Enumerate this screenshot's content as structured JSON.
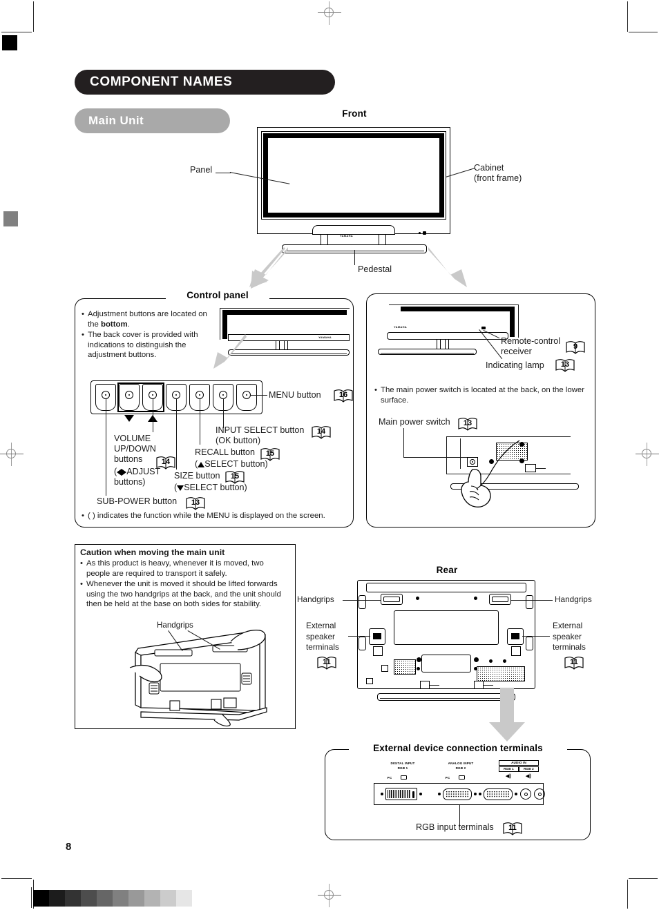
{
  "page": {
    "number": "8",
    "section_title": "COMPONENT NAMES",
    "subsection_title": "Main Unit",
    "brand_logo": "YAMAHA"
  },
  "front": {
    "title": "Front",
    "labels": {
      "panel": "Panel",
      "cabinet": "Cabinet\n(front frame)",
      "pedestal": "Pedestal"
    }
  },
  "control_panel": {
    "title": "Control panel",
    "notes": [
      "Adjustment buttons are located on the bottom.",
      "The back cover is provided with indications to distinguish the adjustment buttons."
    ],
    "note1_pre": "Adjustment buttons are located on the ",
    "note1_bold": "bottom",
    "note1_post": ".",
    "note2": "The back cover is provided with indications to distinguish the adjustment buttons.",
    "callouts": {
      "menu": {
        "label": "MENU button",
        "page": "16"
      },
      "input_select": {
        "label": "INPUT SELECT button\n(OK button)",
        "page": "14"
      },
      "recall": {
        "label": "RECALL button",
        "sub": "SELECT button)",
        "page": "15"
      },
      "size": {
        "label": "SIZE button",
        "sub": "SELECT button)",
        "page": "15"
      },
      "volume": {
        "label": "VOLUME\nUP/DOWN\nbuttons",
        "sub_open": "(",
        "sub_text": "ADJUST\nbuttons)",
        "page": "14"
      },
      "sub_power": {
        "label": "SUB-POWER button",
        "page": "13"
      }
    },
    "footnote": "(    ) indicates the function while the MENU is displayed on the screen."
  },
  "rear_top_panel": {
    "callouts": {
      "remote_receiver": {
        "label": "Remote-control\nreceiver",
        "page": "9"
      },
      "indicating_lamp": {
        "label": "Indicating lamp",
        "page": "13"
      },
      "main_power_switch": {
        "label": "Main power switch",
        "page": "13"
      }
    },
    "note": "The main power switch is located at the back, on the lower surface."
  },
  "caution": {
    "title": "Caution when moving the main unit",
    "items": [
      "As this product is heavy, whenever it is moved, two people are required to transport it safely.",
      "Whenever the unit is moved it should be lifted forwards using the two handgrips at the back, and the unit should then be held at the base on both sides for stability."
    ],
    "handgrips_label": "Handgrips"
  },
  "rear": {
    "title": "Rear",
    "labels": {
      "handgrips_left": "Handgrips",
      "handgrips_right": "Handgrips",
      "speaker_left": "External\nspeaker\nterminals",
      "speaker_right": "External\nspeaker\nterminals",
      "speaker_left_page": "11",
      "speaker_right_page": "11"
    }
  },
  "terminals": {
    "title": "External device connection terminals",
    "rgb_label": "RGB input terminals",
    "rgb_page": "11",
    "plate": {
      "digital_input": "DIGITAL INPUT",
      "digital_rgb": "RGB 1",
      "digital_pc": "PC",
      "analog_input": "ANALOG INPUT",
      "analog_rgb": "RGB 2",
      "analog_pc": "PC",
      "audio_in": "AUDIO IN",
      "audio_rgb1": "RGB 1",
      "audio_rgb2": "RGB 2"
    }
  },
  "print_marks": {
    "grayscale_steps": [
      "#000000",
      "#1c1c1c",
      "#333333",
      "#4d4d4d",
      "#666666",
      "#808080",
      "#999999",
      "#b3b3b3",
      "#cccccc",
      "#e6e6e6"
    ],
    "corner_black": "#000000",
    "corner_gray": "#808080"
  }
}
